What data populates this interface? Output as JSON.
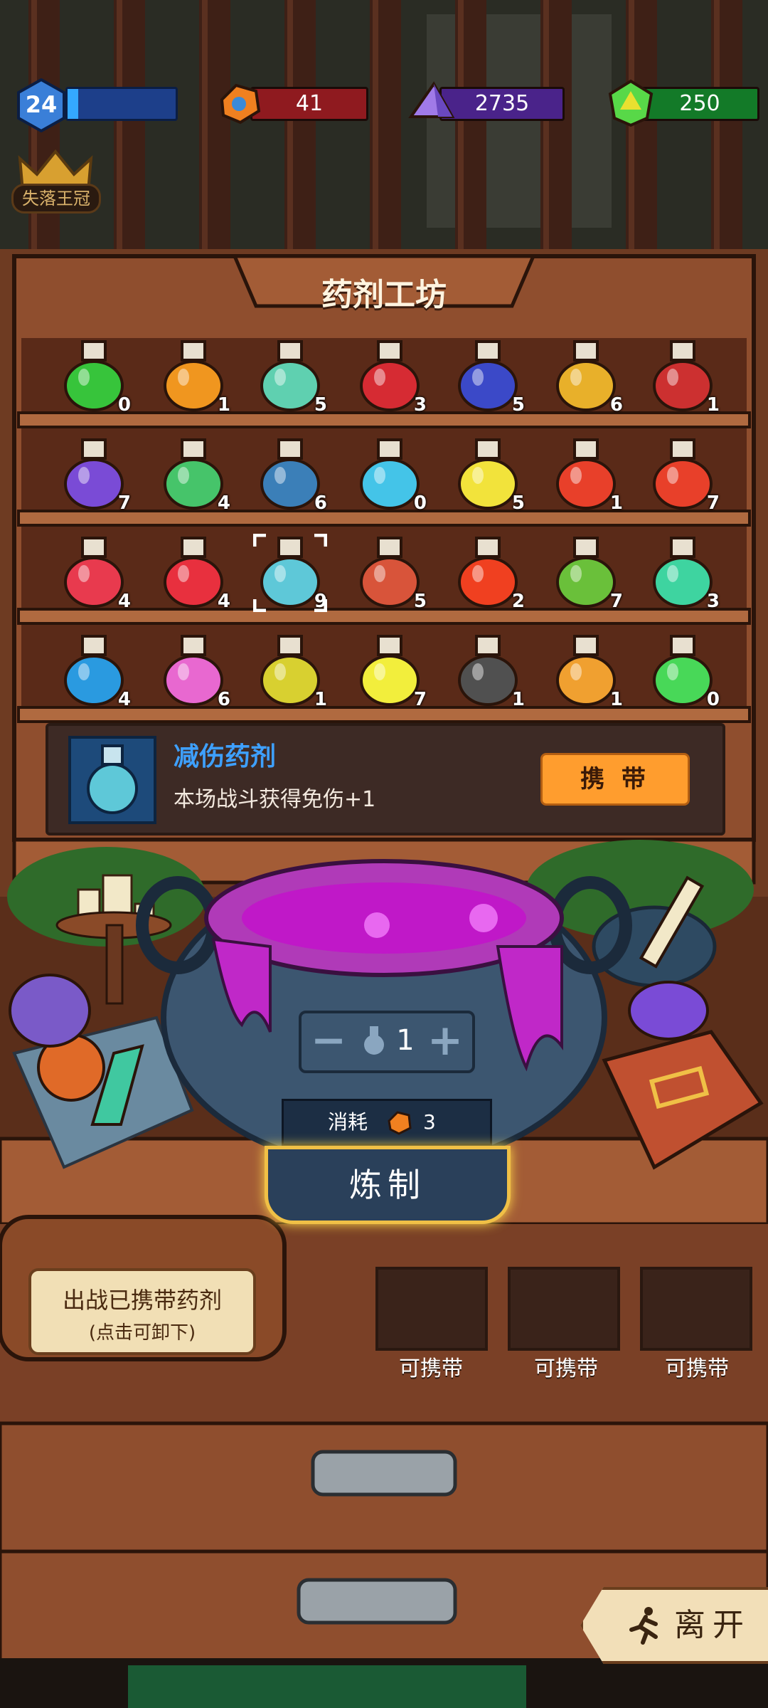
{
  "hud": {
    "level": "24",
    "xp_progress": 0.1,
    "resources": [
      {
        "name": "orange-gem-icon",
        "value": "41",
        "bar_color": "#8f1a1f"
      },
      {
        "name": "purple-crystal-icon",
        "value": "2735",
        "bar_color": "#4a238a"
      },
      {
        "name": "green-gem-icon",
        "value": "250",
        "bar_color": "#137a28"
      }
    ],
    "crown_label": "失落王冠"
  },
  "shelf": {
    "title": "药剂工坊",
    "potions": [
      [
        "0",
        "1",
        "5",
        "3",
        "5",
        "6",
        "1"
      ],
      [
        "7",
        "4",
        "6",
        "0",
        "5",
        "1",
        "7"
      ],
      [
        "4",
        "4",
        "9",
        "5",
        "2",
        "7",
        "3"
      ],
      [
        "4",
        "6",
        "1",
        "7",
        "1",
        "1",
        "0"
      ]
    ],
    "colors": [
      [
        "#37c43b",
        "#f0961f",
        "#5fd0b0",
        "#d62b33",
        "#3b49c8",
        "#e8b02a",
        "#cc3030"
      ],
      [
        "#7a4bd6",
        "#46c46a",
        "#3b7fb8",
        "#44c4e8",
        "#f2e33b",
        "#e8402a",
        "#e8402a"
      ],
      [
        "#e83a4e",
        "#e8303e",
        "#5ec8d8",
        "#d8543a",
        "#f04020",
        "#6ac03a",
        "#3ed4a0"
      ],
      [
        "#2a9ae0",
        "#e868d0",
        "#d8d030",
        "#f2ee3c",
        "#505050",
        "#f0a030",
        "#48d858"
      ]
    ]
  },
  "detail": {
    "name": "减伤药剂",
    "description": "本场战斗获得免伤+1",
    "carry_label": "携 带"
  },
  "brew": {
    "minus": "−",
    "plus": "+",
    "quantity": "1",
    "cost_label": "消耗",
    "cost_value": "3",
    "brew_label": "炼制"
  },
  "carried": {
    "title": "出战已携带药剂",
    "subtitle": "(点击可卸下)",
    "slots": [
      "可携带",
      "可携带",
      "可携带"
    ]
  },
  "leave_label": "离开"
}
